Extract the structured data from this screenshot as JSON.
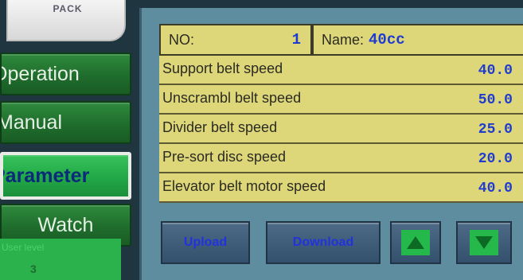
{
  "brand": {
    "logo_text": "PACK"
  },
  "nav": {
    "operation": "Operation",
    "manual": "Manual",
    "parameter": "Parameter",
    "watch": "Watch",
    "active": "parameter"
  },
  "user_level": {
    "label": "User level",
    "value": "3"
  },
  "header": {
    "no_label": "NO:",
    "no_value": "1",
    "name_label": "Name:",
    "name_value": "40cc"
  },
  "parameters": [
    {
      "label": "Support belt speed",
      "value": "40.0"
    },
    {
      "label": "Unscrambl belt speed",
      "value": "50.0"
    },
    {
      "label": "Divider belt speed",
      "value": "25.0"
    },
    {
      "label": "Pre-sort disc speed",
      "value": "20.0"
    },
    {
      "label": "Elevator belt motor speed",
      "value": "40.0"
    }
  ],
  "buttons": {
    "upload": "Upload",
    "download": "Download",
    "up_icon": "arrow-up-icon",
    "down_icon": "arrow-down-icon"
  },
  "colors": {
    "panel_bg": "#5f8da0",
    "cell_bg": "#ded77a",
    "value_text": "#1f3bd0",
    "nav_green": "#1f6d2c",
    "nav_active": "#22a847"
  }
}
